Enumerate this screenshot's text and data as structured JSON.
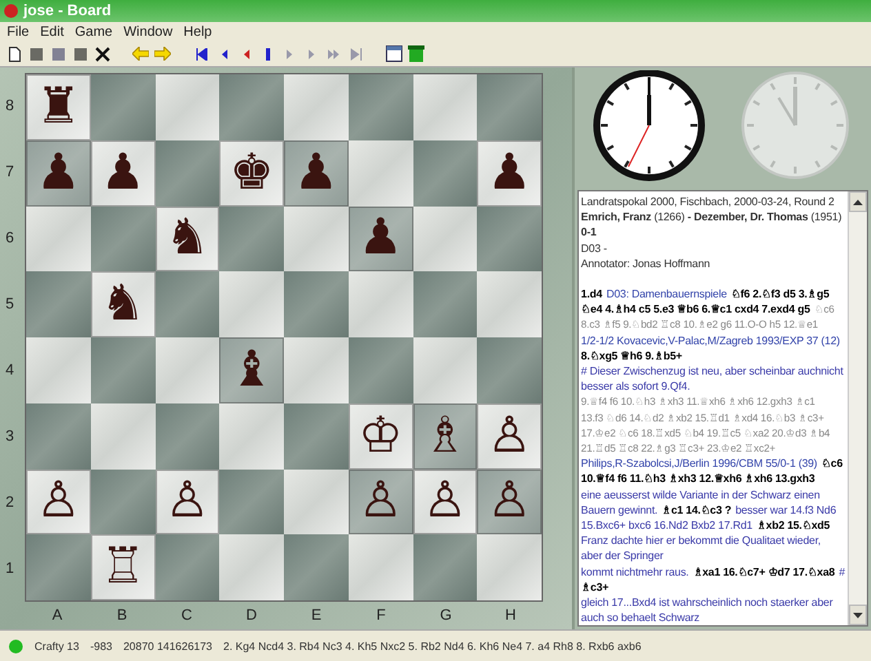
{
  "window": {
    "title": "jose - Board"
  },
  "menu": [
    "File",
    "Edit",
    "Game",
    "Window",
    "Help"
  ],
  "board": {
    "ranks": [
      {
        "label": "8",
        "squares": [
          {
            "occupied": true,
            "piece": "♜"
          },
          {
            "occupied": false
          },
          {
            "occupied": false
          },
          {
            "occupied": false
          },
          {
            "occupied": false
          },
          {
            "occupied": false
          },
          {
            "occupied": false
          },
          {
            "occupied": false
          }
        ]
      },
      {
        "label": "7",
        "squares": [
          {
            "occupied": true,
            "piece": "♟"
          },
          {
            "occupied": true,
            "piece": "♟"
          },
          {
            "occupied": false
          },
          {
            "occupied": true,
            "piece": "♚"
          },
          {
            "occupied": true,
            "piece": "♟"
          },
          {
            "occupied": false
          },
          {
            "occupied": false
          },
          {
            "occupied": true,
            "piece": "♟"
          }
        ]
      },
      {
        "label": "6",
        "squares": [
          {
            "occupied": false
          },
          {
            "occupied": false
          },
          {
            "occupied": true,
            "piece": "♞"
          },
          {
            "occupied": false
          },
          {
            "occupied": false
          },
          {
            "occupied": true,
            "piece": "♟"
          },
          {
            "occupied": false
          },
          {
            "occupied": false
          }
        ]
      },
      {
        "label": "5",
        "squares": [
          {
            "occupied": false
          },
          {
            "occupied": true,
            "piece": "♞"
          },
          {
            "occupied": false
          },
          {
            "occupied": false
          },
          {
            "occupied": false
          },
          {
            "occupied": false
          },
          {
            "occupied": false
          },
          {
            "occupied": false
          }
        ]
      },
      {
        "label": "4",
        "squares": [
          {
            "occupied": false
          },
          {
            "occupied": false
          },
          {
            "occupied": false
          },
          {
            "occupied": true,
            "piece": "♝"
          },
          {
            "occupied": false
          },
          {
            "occupied": false
          },
          {
            "occupied": false
          },
          {
            "occupied": false
          }
        ]
      },
      {
        "label": "3",
        "squares": [
          {
            "occupied": false
          },
          {
            "occupied": false
          },
          {
            "occupied": false
          },
          {
            "occupied": false
          },
          {
            "occupied": false
          },
          {
            "occupied": true,
            "piece": "♔"
          },
          {
            "occupied": true,
            "piece": "♗"
          },
          {
            "occupied": true,
            "piece": "♙"
          }
        ]
      },
      {
        "label": "2",
        "squares": [
          {
            "occupied": true,
            "piece": "♙"
          },
          {
            "occupied": false
          },
          {
            "occupied": true,
            "piece": "♙"
          },
          {
            "occupied": false
          },
          {
            "occupied": false
          },
          {
            "occupied": true,
            "piece": "♙"
          },
          {
            "occupied": true,
            "piece": "♙"
          },
          {
            "occupied": true,
            "piece": "♙"
          }
        ]
      },
      {
        "label": "1",
        "squares": [
          {
            "occupied": false
          },
          {
            "occupied": true,
            "piece": "♖"
          },
          {
            "occupied": false
          },
          {
            "occupied": false
          },
          {
            "occupied": false
          },
          {
            "occupied": false
          },
          {
            "occupied": false
          },
          {
            "occupied": false
          }
        ]
      }
    ],
    "files": [
      "A",
      "B",
      "C",
      "D",
      "E",
      "F",
      "G",
      "H"
    ]
  },
  "header": [
    {
      "kind": "plain",
      "text": "Landratspokal 2000, Fischbach, 2000-03-24, Round 2"
    },
    {
      "kind": "plain",
      "text": "**Emrich, Franz** (1266) **- Dezember, Dr. Thomas** (1951)"
    },
    {
      "kind": "result",
      "text": "0-1"
    },
    {
      "kind": "plain",
      "text": "D03 -"
    },
    {
      "kind": "plain",
      "text": "Annotator: Jonas Hoffmann"
    }
  ],
  "notation": [
    [
      {
        "kind": "main",
        "text": "1.d4"
      },
      {
        "kind": "eco",
        "text": "D03: Damenbauernspiele"
      },
      {
        "kind": "main",
        "text": "♘f6 2.♘f3 d5 3.♗g5"
      }
    ],
    [
      {
        "kind": "main",
        "text": "♘e4 4.♗h4 c5 5.e3 ♕b6 6.♕c1 cxd4 7.exd4 g5"
      },
      {
        "kind": "variation",
        "text": "♘c6"
      }
    ],
    [
      {
        "kind": "variation",
        "text": "8.c3 ♗f5 9.♘bd2 ♖c8 10.♗e2 g6 11.O-O h5 12.♕e1"
      }
    ],
    [
      {
        "kind": "eco",
        "text": "1/2-1/2 Kovacevic,V-Palac,M/Zagreb 1993/EXP 37 (12)"
      }
    ],
    [
      {
        "kind": "main",
        "text": "8.♘xg5 ♕h6 9.♗b5+"
      }
    ],
    [
      {
        "kind": "comment",
        "text": "# Dieser Zwischenzug ist neu, aber scheinbar auchnicht"
      }
    ],
    [
      {
        "kind": "comment",
        "text": "besser als sofort 9.Qf4."
      }
    ],
    [
      {
        "kind": "variation",
        "text": "9.♕f4 f6 10.♘h3 ♗xh3 11.♕xh6 ♗xh6 12.gxh3 ♗c1"
      }
    ],
    [
      {
        "kind": "variation",
        "text": "13.f3 ♘d6 14.♘d2 ♗xb2 15.♖d1 ♗xd4 16.♘b3 ♗c3+"
      }
    ],
    [
      {
        "kind": "variation",
        "text": "17.♔e2 ♘c6 18.♖xd5 ♘b4 19.♖c5 ♘xa2 20.♔d3 ♗b4"
      }
    ],
    [
      {
        "kind": "variation",
        "text": "21.♖d5 ♖c8 22.♗g3 ♖c3+ 23.♔e2 ♖xc2+"
      }
    ],
    [
      {
        "kind": "eco",
        "text": "Philips,R-Szabolcsi,J/Berlin 1996/CBM 55/0-1 (39)"
      },
      {
        "kind": "main",
        "text": "♘c6"
      }
    ],
    [
      {
        "kind": "main",
        "text": "10.♕f4 f6 11.♘h3 ♗xh3 12.♕xh6 ♗xh6 13.gxh3"
      }
    ],
    [
      {
        "kind": "comment",
        "text": "eine aeusserst wilde Variante in der Schwarz einen"
      }
    ],
    [
      {
        "kind": "comment",
        "text": "Bauern gewinnt."
      },
      {
        "kind": "main",
        "text": "♗c1 14.♘c3 ?"
      },
      {
        "kind": "comment",
        "text": "besser war 14.f3 Nd6"
      }
    ],
    [
      {
        "kind": "comment",
        "text": "15.Bxc6+ bxc6 16.Nd2 Bxb2 17.Rd1"
      },
      {
        "kind": "main",
        "text": "♗xb2 15.♘xd5"
      }
    ],
    [
      {
        "kind": "comment",
        "text": "Franz dachte hier er bekommt die Qualitaet wieder,"
      }
    ],
    [
      {
        "kind": "comment",
        "text": "aber der Springer"
      }
    ],
    [
      {
        "kind": "comment",
        "text": "kommt nichtmehr raus."
      },
      {
        "kind": "main",
        "text": "♗xa1 16.♘c7+ ♔d7 17.♘xa8"
      },
      {
        "kind": "comment",
        "text": "#"
      }
    ],
    [
      {
        "kind": "main",
        "text": "♗c3+"
      }
    ],
    [
      {
        "kind": "comment",
        "text": "gleich 17...Bxd4 ist wahrscheinlich noch staerker aber"
      }
    ],
    [
      {
        "kind": "comment",
        "text": "auch so behaelt Schwarz"
      }
    ]
  ],
  "status_bar": {
    "engine": "Crafty 13",
    "score": "-983",
    "nodes": "20870 141626173",
    "line": "2. Kg4 Ncd4 3. Rb4 Nc3 4. Kh5 Nxc2 5. Rb2 Nd4 6. Kh6 Ne4 7. a4 Rh8 8. Rxb6 axb6"
  }
}
